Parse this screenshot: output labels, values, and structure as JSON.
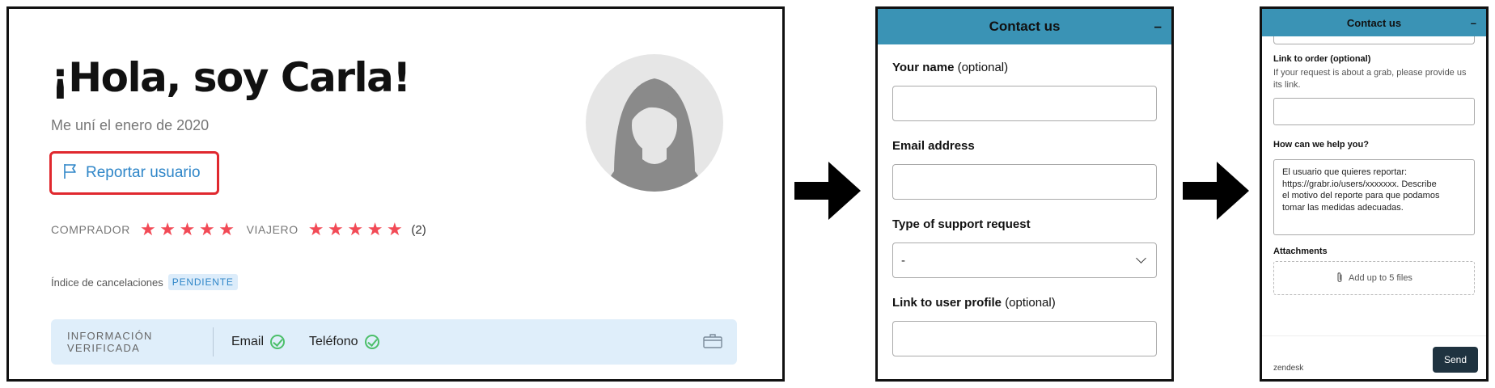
{
  "profile": {
    "title": "¡Hola, soy Carla!",
    "joined": "Me uní el enero de 2020",
    "report_label": "Reportar usuario",
    "buyer_label": "COMPRADOR",
    "buyer_rating": 5,
    "traveler_label": "VIAJERO",
    "traveler_rating": 5,
    "review_count": "(2)",
    "cancel_label": "Índice de cancelaciones",
    "cancel_badge": "PENDIENTE",
    "verified_label": "INFORMACIÓN VERIFICADA",
    "verified_items": [
      "Email",
      "Teléfono"
    ],
    "accent_color": "#2f86c8",
    "highlight_color": "#e0282e",
    "star_color": "#f24a56"
  },
  "contact_form": {
    "header": "Contact us",
    "minimize_glyph": "–",
    "header_color": "#3a93b5",
    "name_label": "Your name",
    "name_optional": "(optional)",
    "email_label": "Email address",
    "type_label": "Type of support request",
    "type_value": "-",
    "profile_link_label": "Link to user profile",
    "profile_link_optional": "(optional)"
  },
  "contact_form_2": {
    "header": "Contact us",
    "minimize_glyph": "–",
    "order_label": "Link to order (optional)",
    "order_help": "If your request is about a grab, please provide us its link.",
    "help_label": "How can we help you?",
    "help_text": "El usuario que quieres reportar:\nhttps://grabr.io/users/xxxxxxx. Describe\nel motivo del reporte para que podamos\ntomar las medidas adecuadas.",
    "attachments_label": "Attachments",
    "attachments_hint": "Add up to 5 files",
    "brand": "zendesk",
    "send_label": "Send"
  }
}
